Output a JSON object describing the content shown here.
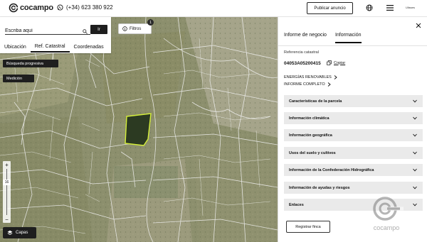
{
  "header": {
    "brand": "cocampo",
    "phone": "(+34) 623 380 922",
    "publish_label": "Publicar anuncio",
    "mini_brand": "Ulisses"
  },
  "search": {
    "placeholder": "Escriba aquí",
    "value": "Escriba aquí",
    "go_label": "Ir",
    "tabs": [
      "Ubicación",
      "Ref. Catastral",
      "Coordenadas"
    ],
    "active_tab": "Ref. Catastral"
  },
  "map_controls": {
    "progressive_label": "Búsqueda progresiva",
    "measure_label": "Medición",
    "filters_label": "Filtros",
    "filters_count": "1",
    "zoom_level": "16",
    "zoom_in": "+",
    "zoom_out": "−",
    "layers_label": "Capas"
  },
  "panel": {
    "tabs": [
      "Informe de negocio",
      "Información"
    ],
    "active_tab": "Información",
    "ref_label": "Referencia catastral",
    "ref_value": "04053A05200415",
    "copy_label": "Copiar",
    "links": [
      "ENERGÍAS RENOVABLES",
      "INFORME COMPLETO"
    ],
    "sections": [
      "Características de la parcela",
      "Información climática",
      "Información geográfica",
      "Usos del suelo y cultivos",
      "Información de la Confederación Hidrográfica",
      "Información de ayudas y riesgos",
      "Enlaces"
    ],
    "register_label": "Registrar finca",
    "watermark": "cocampo"
  },
  "colors": {
    "accent_dark": "#1e1e1e",
    "parcel_highlight": "#d6f03a",
    "accordion_bg": "#eaeaea"
  }
}
